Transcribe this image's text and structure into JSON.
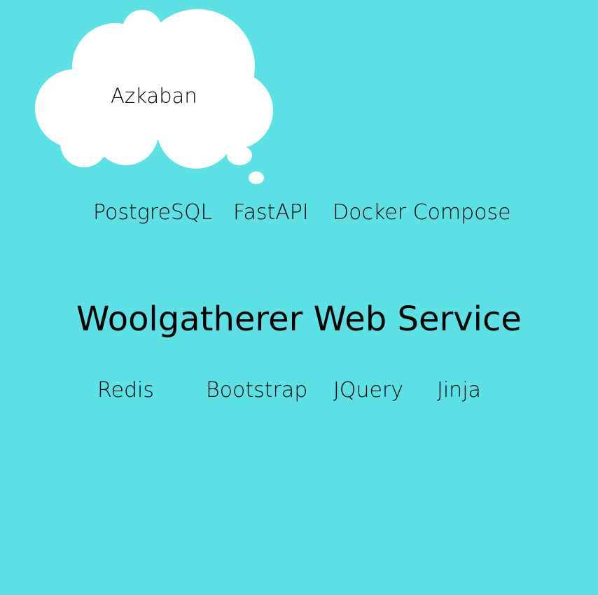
{
  "colors": {
    "background": "#5ce1e6",
    "cloud": "#ffffff",
    "text": "#000000"
  },
  "cloud": {
    "label": "Azkaban"
  },
  "top_row": [
    "PostgreSQL",
    "FastAPI",
    "Docker Compose"
  ],
  "title": "Woolgatherer Web Service",
  "bottom_row": [
    "Redis",
    "Bootstrap",
    "JQuery",
    "Jinja"
  ]
}
